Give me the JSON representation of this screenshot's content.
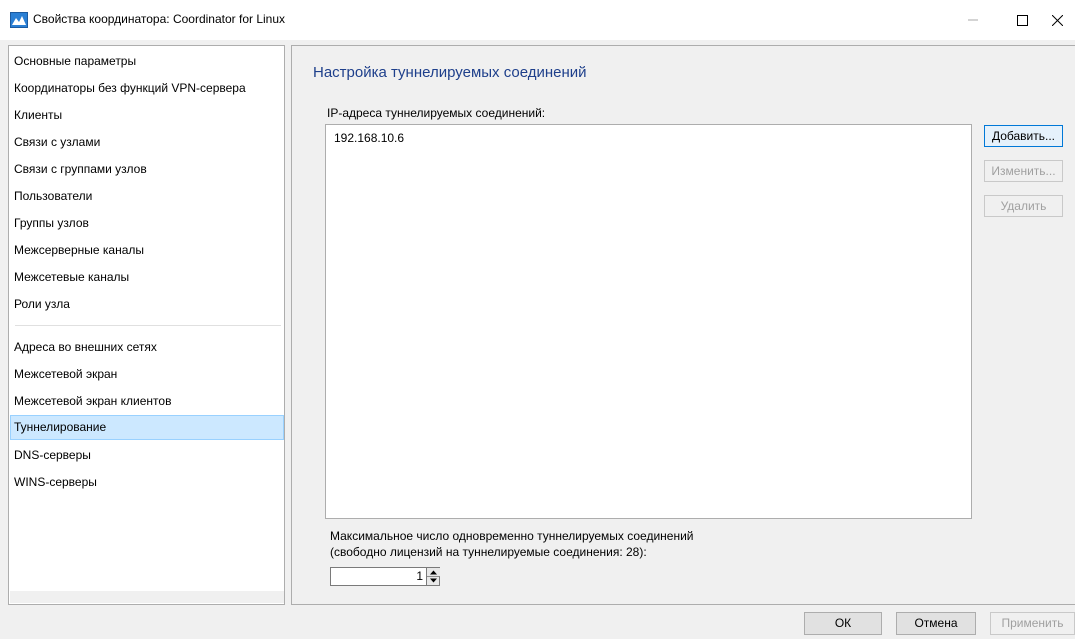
{
  "window": {
    "title": "Свойства координатора: Coordinator for Linux"
  },
  "sidebar": {
    "items": [
      {
        "label": "Основные параметры"
      },
      {
        "label": "Координаторы без функций VPN-сервера"
      },
      {
        "label": "Клиенты"
      },
      {
        "label": "Связи с узлами"
      },
      {
        "label": "Связи с группами узлов"
      },
      {
        "label": "Пользователи"
      },
      {
        "label": "Группы узлов"
      },
      {
        "label": "Межсерверные каналы"
      },
      {
        "label": "Межсетевые каналы"
      },
      {
        "label": "Роли узла"
      },
      {
        "label": "Адреса во внешних сетях"
      },
      {
        "label": "Межсетевой экран"
      },
      {
        "label": "Межсетевой экран клиентов"
      },
      {
        "label": "Туннелирование"
      },
      {
        "label": "DNS-серверы"
      },
      {
        "label": "WINS-серверы"
      }
    ],
    "selected": "Туннелирование"
  },
  "main": {
    "section_title": "Настройка туннелируемых соединений",
    "ip_list_label": "IP-адреса туннелируемых соединений:",
    "ip_addresses": [
      "192.168.10.6"
    ],
    "buttons": {
      "add": "Добавить...",
      "edit": "Изменить...",
      "delete": "Удалить"
    },
    "max_connections_label_line1": "Максимальное число одновременно туннелируемых соединений",
    "max_connections_label_line2": "(свободно лицензий на туннелируемые соединения: 28):",
    "max_connections_value": "1"
  },
  "footer": {
    "ok": "ОК",
    "cancel": "Отмена",
    "apply": "Применить"
  },
  "colors": {
    "section_title": "#1e3f8b",
    "selection_bg": "#cce8ff",
    "selection_border": "#99d1ff",
    "disabled_text": "#a0a0a0"
  }
}
